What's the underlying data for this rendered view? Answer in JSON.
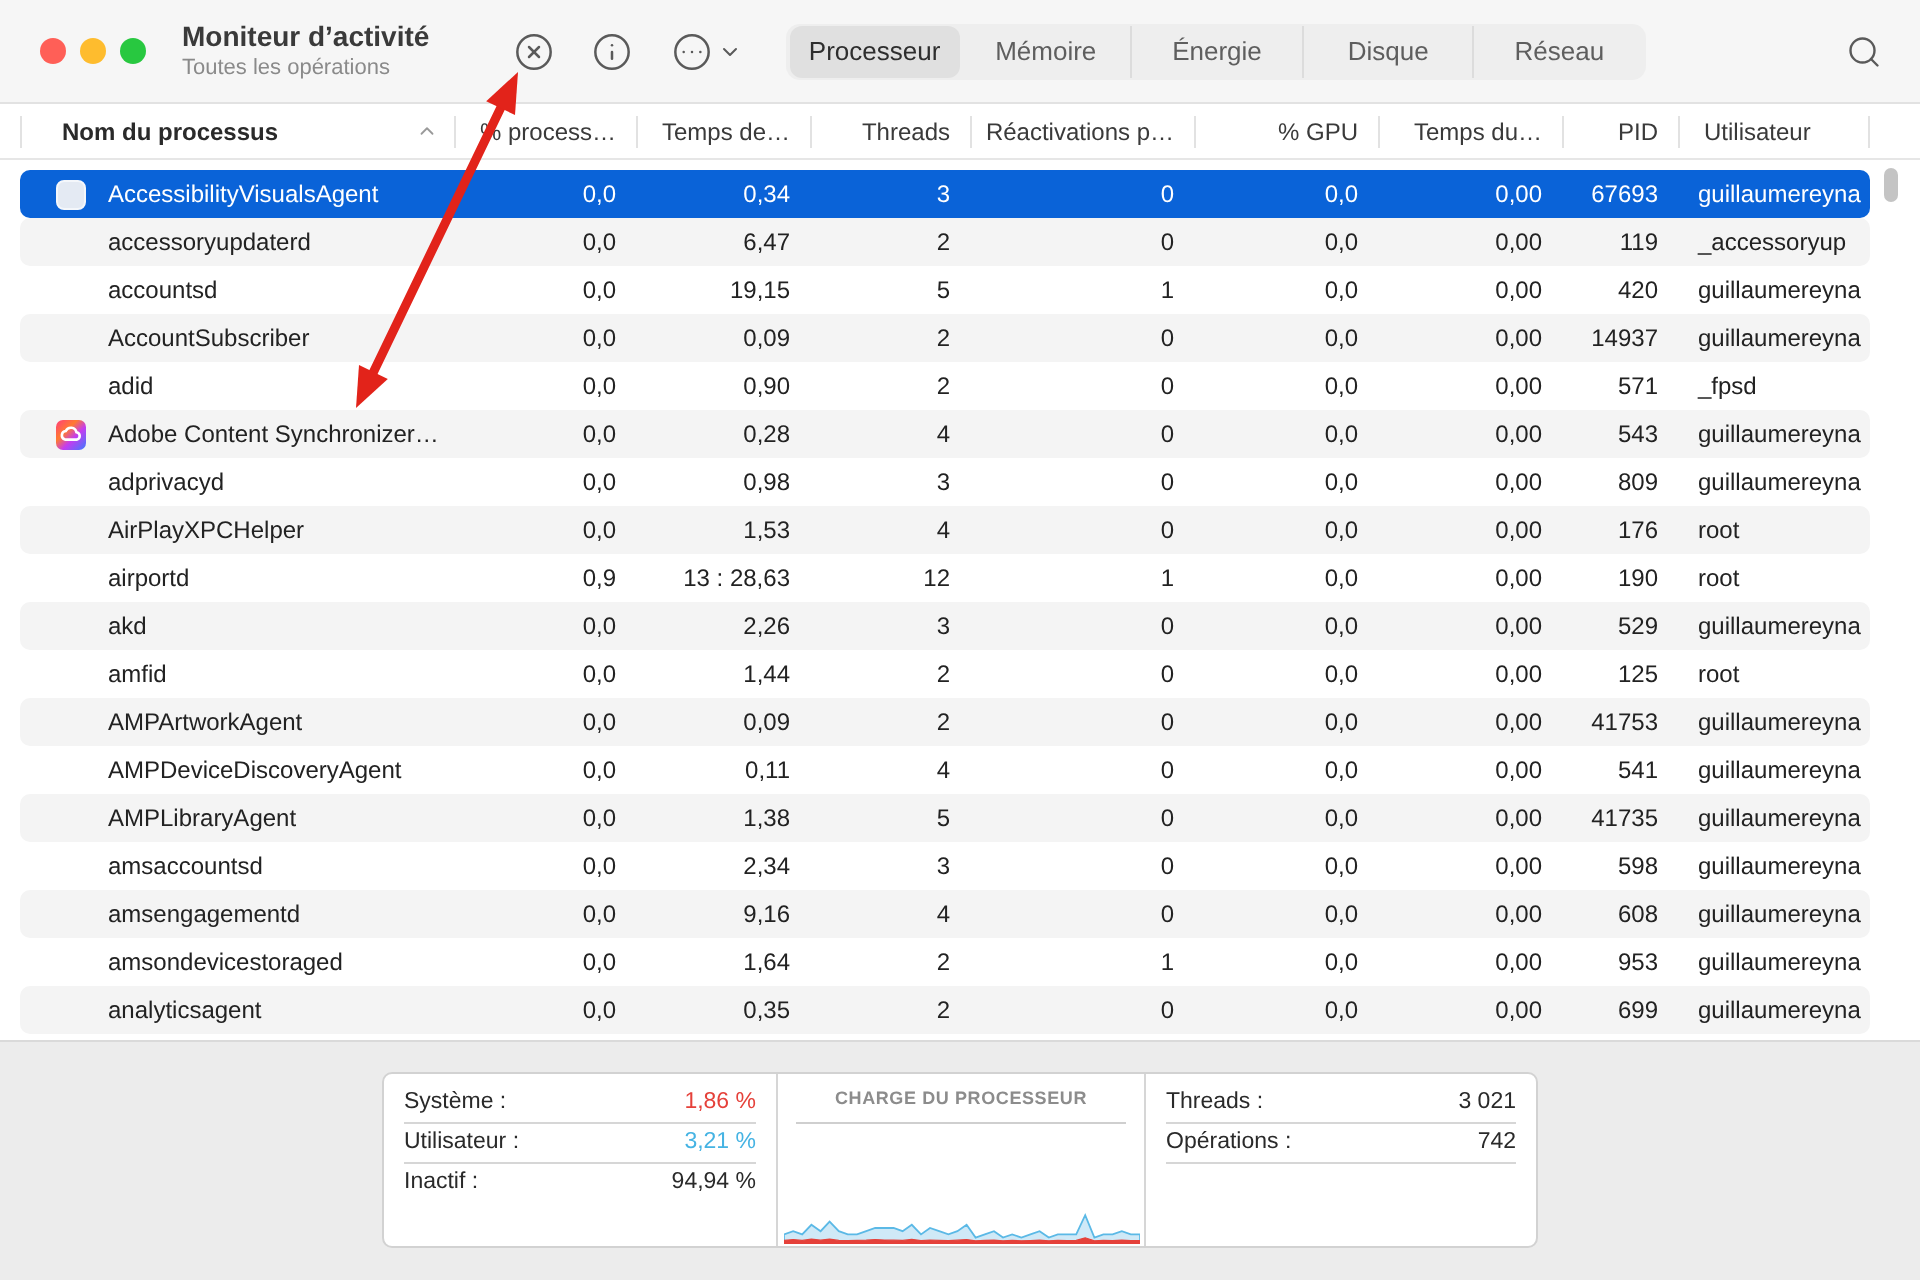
{
  "window": {
    "title": "Moniteur d’activité",
    "subtitle": "Toutes les opérations"
  },
  "tabs": [
    {
      "label": "Processeur",
      "selected": true
    },
    {
      "label": "Mémoire",
      "selected": false
    },
    {
      "label": "Énergie",
      "selected": false
    },
    {
      "label": "Disque",
      "selected": false
    },
    {
      "label": "Réseau",
      "selected": false
    }
  ],
  "table": {
    "columns": [
      {
        "label": "Nom du processus",
        "sorted": true
      },
      {
        "label": "% process…",
        "sorted": false
      },
      {
        "label": "Temps de…",
        "sorted": false
      },
      {
        "label": "Threads",
        "sorted": false
      },
      {
        "label": "Réactivations p…",
        "sorted": false
      },
      {
        "label": "% GPU",
        "sorted": false
      },
      {
        "label": "Temps du…",
        "sorted": false
      },
      {
        "label": "PID",
        "sorted": false
      },
      {
        "label": "Utilisateur",
        "sorted": false
      }
    ],
    "rows": [
      {
        "kind": "blank",
        "selected": true,
        "cells": [
          "AccessibilityVisualsAgent",
          "0,0",
          "0,34",
          "3",
          "0",
          "0,0",
          "0,00",
          "67693",
          "guillaumereyna"
        ]
      },
      {
        "kind": "plain",
        "selected": false,
        "cells": [
          "accessoryupdaterd",
          "0,0",
          "6,47",
          "2",
          "0",
          "0,0",
          "0,00",
          "119",
          "_accessoryup"
        ]
      },
      {
        "kind": "plain",
        "selected": false,
        "cells": [
          "accountsd",
          "0,0",
          "19,15",
          "5",
          "1",
          "0,0",
          "0,00",
          "420",
          "guillaumereyna"
        ]
      },
      {
        "kind": "plain",
        "selected": false,
        "cells": [
          "AccountSubscriber",
          "0,0",
          "0,09",
          "2",
          "0",
          "0,0",
          "0,00",
          "14937",
          "guillaumereyna"
        ]
      },
      {
        "kind": "plain",
        "selected": false,
        "cells": [
          "adid",
          "0,0",
          "0,90",
          "2",
          "0",
          "0,0",
          "0,00",
          "571",
          "_fpsd"
        ]
      },
      {
        "kind": "logo",
        "selected": false,
        "cells": [
          "Adobe Content Synchronizer…",
          "0,0",
          "0,28",
          "4",
          "0",
          "0,0",
          "0,00",
          "543",
          "guillaumereyna"
        ]
      },
      {
        "kind": "plain",
        "selected": false,
        "cells": [
          "adprivacyd",
          "0,0",
          "0,98",
          "3",
          "0",
          "0,0",
          "0,00",
          "809",
          "guillaumereyna"
        ]
      },
      {
        "kind": "plain",
        "selected": false,
        "cells": [
          "AirPlayXPCHelper",
          "0,0",
          "1,53",
          "4",
          "0",
          "0,0",
          "0,00",
          "176",
          "root"
        ]
      },
      {
        "kind": "plain",
        "selected": false,
        "cells": [
          "airportd",
          "0,9",
          "13 : 28,63",
          "12",
          "1",
          "0,0",
          "0,00",
          "190",
          "root"
        ]
      },
      {
        "kind": "plain",
        "selected": false,
        "cells": [
          "akd",
          "0,0",
          "2,26",
          "3",
          "0",
          "0,0",
          "0,00",
          "529",
          "guillaumereyna"
        ]
      },
      {
        "kind": "plain",
        "selected": false,
        "cells": [
          "amfid",
          "0,0",
          "1,44",
          "2",
          "0",
          "0,0",
          "0,00",
          "125",
          "root"
        ]
      },
      {
        "kind": "plain",
        "selected": false,
        "cells": [
          "AMPArtworkAgent",
          "0,0",
          "0,09",
          "2",
          "0",
          "0,0",
          "0,00",
          "41753",
          "guillaumereyna"
        ]
      },
      {
        "kind": "plain",
        "selected": false,
        "cells": [
          "AMPDeviceDiscoveryAgent",
          "0,0",
          "0,11",
          "4",
          "0",
          "0,0",
          "0,00",
          "541",
          "guillaumereyna"
        ]
      },
      {
        "kind": "plain",
        "selected": false,
        "cells": [
          "AMPLibraryAgent",
          "0,0",
          "1,38",
          "5",
          "0",
          "0,0",
          "0,00",
          "41735",
          "guillaumereyna"
        ]
      },
      {
        "kind": "plain",
        "selected": false,
        "cells": [
          "amsaccountsd",
          "0,0",
          "2,34",
          "3",
          "0",
          "0,0",
          "0,00",
          "598",
          "guillaumereyna"
        ]
      },
      {
        "kind": "plain",
        "selected": false,
        "cells": [
          "amsengagementd",
          "0,0",
          "9,16",
          "4",
          "0",
          "0,0",
          "0,00",
          "608",
          "guillaumereyna"
        ]
      },
      {
        "kind": "plain",
        "selected": false,
        "cells": [
          "amsondevicestoraged",
          "0,0",
          "1,64",
          "2",
          "1",
          "0,0",
          "0,00",
          "953",
          "guillaumereyna"
        ]
      },
      {
        "kind": "plain",
        "selected": false,
        "cells": [
          "analyticsagent",
          "0,0",
          "0,35",
          "2",
          "0",
          "0,0",
          "0,00",
          "699",
          "guillaumereyna"
        ]
      }
    ]
  },
  "summary": {
    "left": [
      {
        "label": "Système :",
        "value": "1,86 %",
        "color": "#e5413a"
      },
      {
        "label": "Utilisateur :",
        "value": "3,21 %",
        "color": "#45b3e3"
      },
      {
        "label": "Inactif :",
        "value": "94,94 %"
      }
    ],
    "chart_title": "CHARGE DU PROCESSEUR",
    "right": [
      {
        "label": "Threads :",
        "value": "3 021"
      },
      {
        "label": "Opérations :",
        "value": "742"
      }
    ]
  }
}
